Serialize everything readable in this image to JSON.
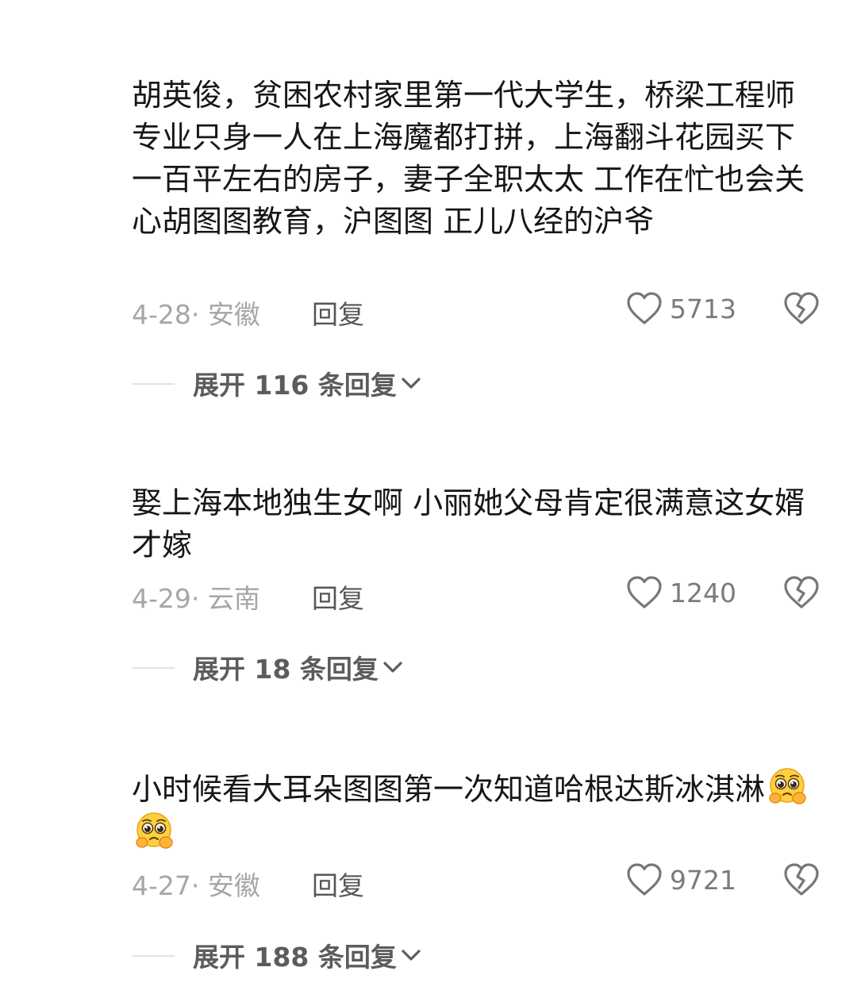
{
  "comments": [
    {
      "text": "胡英俊，贫困农村家里第一代大学生，桥梁工程师专业只身一人在上海魔都打拼，上海翻斗花园买下一百平左右的房子，妻子全职太太 工作在忙也会关心胡图图教育，沪图图 正儿八经的沪爷",
      "meta": "4-28· 安徽",
      "reply_label": "回复",
      "like_count": "5713",
      "expand_label": "展开 116 条回复"
    },
    {
      "text": "娶上海本地独生女啊 小丽她父母肯定很满意这女婿才嫁",
      "meta": "4-29· 云南",
      "reply_label": "回复",
      "like_count": "1240",
      "expand_label": "展开 18 条回复"
    },
    {
      "text": "小时候看大耳朵图图第一次知道哈根达斯冰淇淋",
      "meta": "4-27· 安徽",
      "reply_label": "回复",
      "like_count": "9721",
      "expand_label": "展开 188 条回复",
      "emojis": [
        "pleading-face-emoji",
        "pleading-face-emoji"
      ]
    }
  ],
  "icons": {
    "like": "heart-outline-icon",
    "dislike": "broken-heart-icon",
    "expand": "chevron-down-icon"
  },
  "colors": {
    "text": "#161616",
    "meta": "#a6a6a6",
    "reply": "#565656",
    "expand": "#5c5c5c"
  }
}
